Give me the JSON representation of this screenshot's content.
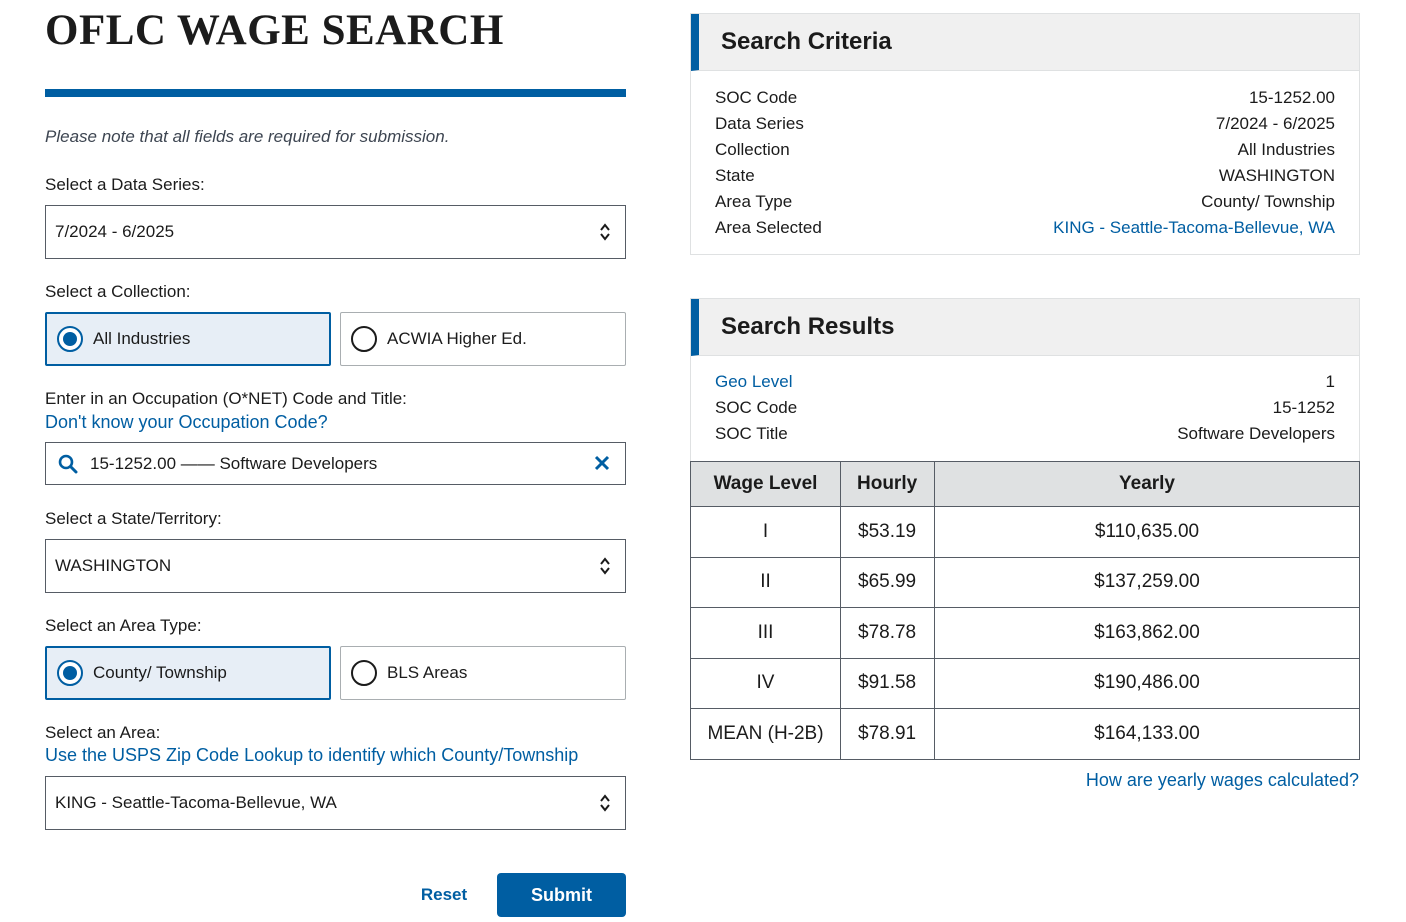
{
  "page": {
    "title": "OFLC WAGE SEARCH",
    "required_note": "Please note that all fields are required for submission."
  },
  "form": {
    "data_series": {
      "label": "Select a Data Series:",
      "value": "7/2024 - 6/2025"
    },
    "collection": {
      "label": "Select a Collection:",
      "options": [
        {
          "label": "All Industries",
          "checked": true
        },
        {
          "label": "ACWIA Higher Ed.",
          "checked": false
        }
      ]
    },
    "occupation": {
      "label": "Enter in an Occupation (O*NET) Code and Title:",
      "help_link": "Don't know your Occupation Code?",
      "value": "15-1252.00 —— Software Developers"
    },
    "state": {
      "label": "Select a State/Territory:",
      "value": "WASHINGTON"
    },
    "area_type": {
      "label": "Select an Area Type:",
      "options": [
        {
          "label": "County/ Township",
          "checked": true
        },
        {
          "label": "BLS Areas",
          "checked": false
        }
      ]
    },
    "area": {
      "label": "Select an Area:",
      "help_link": "Use the USPS Zip Code Lookup to identify which County/Township",
      "value": "KING - Seattle-Tacoma-Bellevue, WA"
    },
    "reset_label": "Reset",
    "submit_label": "Submit"
  },
  "criteria": {
    "heading": "Search Criteria",
    "rows": [
      {
        "k": "SOC Code",
        "v": "15-1252.00"
      },
      {
        "k": "Data Series",
        "v": "7/2024 - 6/2025"
      },
      {
        "k": "Collection",
        "v": "All Industries"
      },
      {
        "k": "State",
        "v": "WASHINGTON"
      },
      {
        "k": "Area Type",
        "v": "County/ Township"
      },
      {
        "k": "Area Selected",
        "v": "KING - Seattle-Tacoma-Bellevue, WA"
      }
    ]
  },
  "results": {
    "heading": "Search Results",
    "rows": [
      {
        "k": "Geo Level",
        "v": "1"
      },
      {
        "k": "SOC Code",
        "v": "15-1252"
      },
      {
        "k": "SOC Title",
        "v": "Software Developers"
      }
    ],
    "table": {
      "headers": [
        "Wage Level",
        "Hourly",
        "Yearly"
      ],
      "rows": [
        [
          "I",
          "$53.19",
          "$110,635.00"
        ],
        [
          "II",
          "$65.99",
          "$137,259.00"
        ],
        [
          "III",
          "$78.78",
          "$163,862.00"
        ],
        [
          "IV",
          "$91.58",
          "$190,486.00"
        ],
        [
          "MEAN (H-2B)",
          "$78.91",
          "$164,133.00"
        ]
      ]
    },
    "yearly_link": "How are yearly wages calculated?"
  },
  "colors": {
    "primary": "#005ea2",
    "text": "#1b1b1b",
    "header_bg": "#f0f0f0"
  }
}
